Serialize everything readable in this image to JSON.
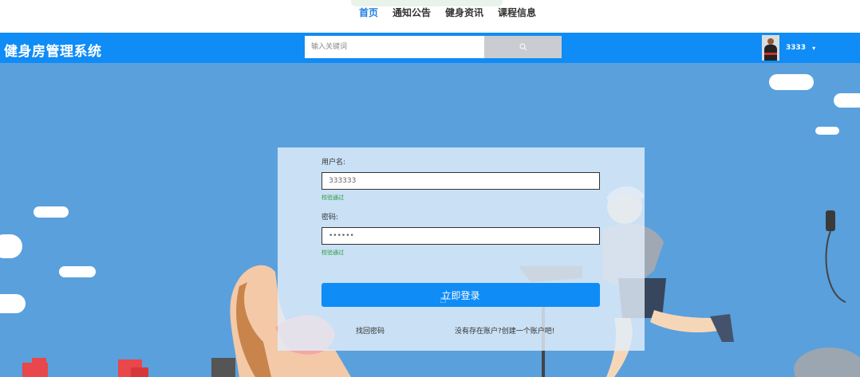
{
  "nav": {
    "items": [
      {
        "label": "首页",
        "active": true
      },
      {
        "label": "通知公告",
        "active": false
      },
      {
        "label": "健身资讯",
        "active": false
      },
      {
        "label": "课程信息",
        "active": false
      }
    ]
  },
  "header": {
    "brand": "健身房管理系统",
    "search_placeholder": "输入关键词",
    "search_icon": "search-icon",
    "user_name": "3333",
    "user_caret": "▾"
  },
  "login": {
    "username_label": "用户名:",
    "username_value": "333333",
    "username_status": "校验通过",
    "password_label": "密码:",
    "password_value": "••••••",
    "password_status": "校验通过",
    "submit_label": "立即登录",
    "forgot_label": "找回密码",
    "register_label": "没有存在账户?创建一个账户吧!"
  },
  "colors": {
    "primary": "#0f8cf6",
    "background": "#5aa0dc",
    "success": "#2e9a3e"
  }
}
